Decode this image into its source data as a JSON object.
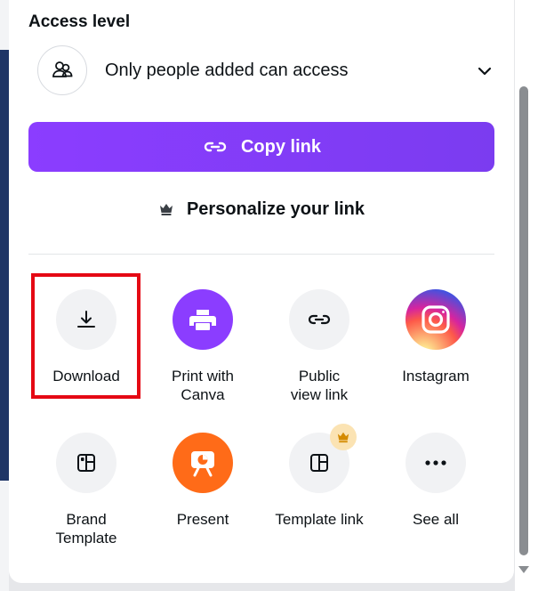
{
  "access": {
    "title": "Access level",
    "value": "Only people added can access"
  },
  "copy_link": {
    "label": "Copy link"
  },
  "personalize": {
    "label": "Personalize your link"
  },
  "share_options": [
    {
      "label": "Download",
      "icon": "download-icon"
    },
    {
      "label": "Print with\nCanva",
      "icon": "print-icon"
    },
    {
      "label": "Public\nview link",
      "icon": "link-icon"
    },
    {
      "label": "Instagram",
      "icon": "instagram-icon"
    },
    {
      "label": "Brand\nTemplate",
      "icon": "brand-template-icon"
    },
    {
      "label": "Present",
      "icon": "present-icon"
    },
    {
      "label": "Template link",
      "icon": "template-link-icon",
      "premium": true
    },
    {
      "label": "See all",
      "icon": "more-icon"
    }
  ],
  "colors": {
    "primary": "#8b3dff",
    "print_circle": "#8b3dff",
    "present_circle": "#ff6b18",
    "highlight": "#e50914",
    "premium_badge": "#fbe3b3"
  }
}
